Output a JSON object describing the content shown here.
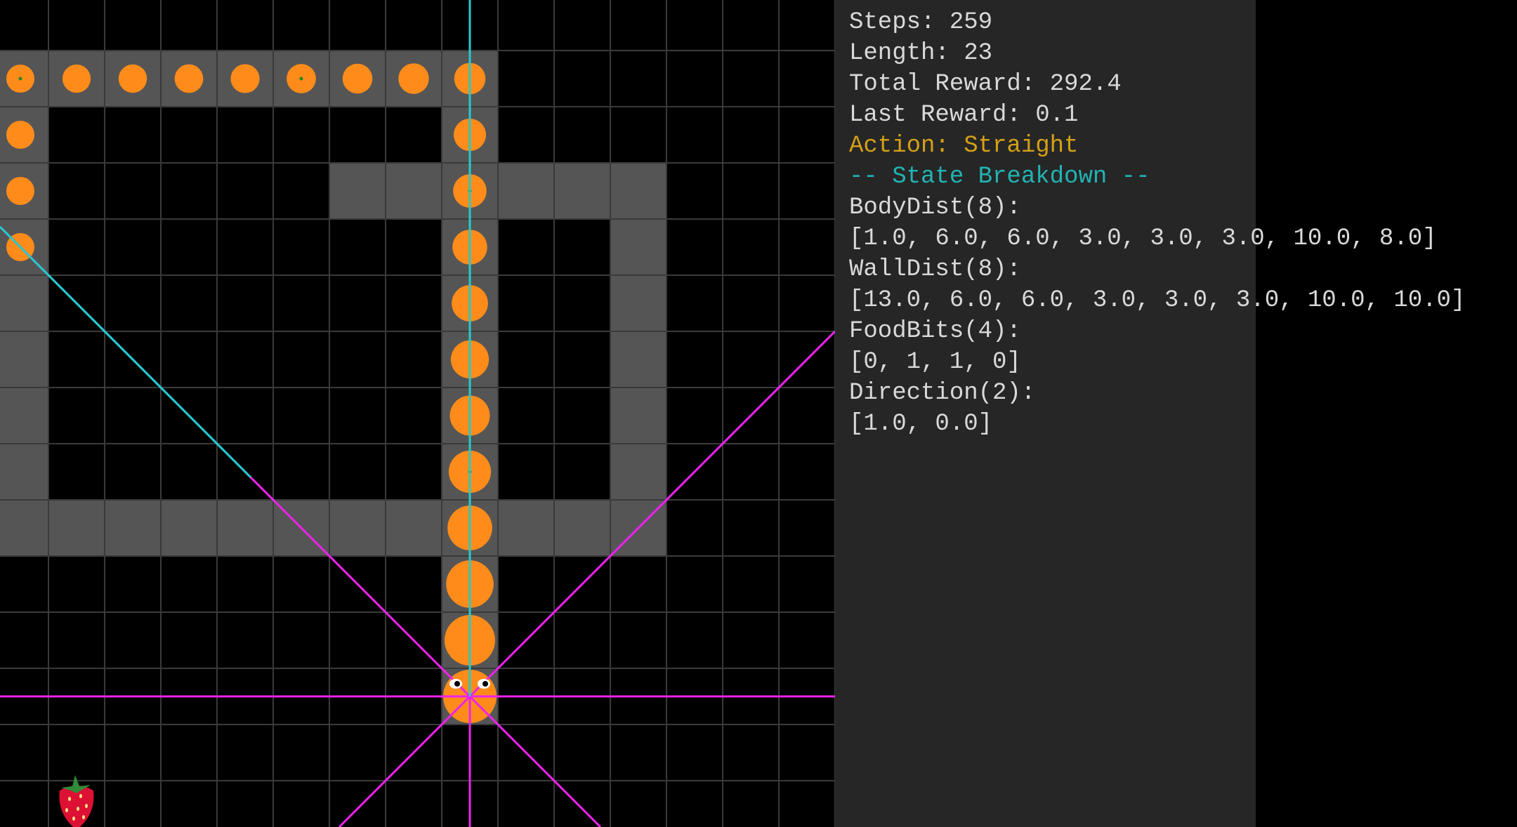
{
  "hud": {
    "lines": [
      {
        "text": "Steps: 259",
        "kind": "normal"
      },
      {
        "text": "Length: 23",
        "kind": "normal"
      },
      {
        "text": "Total Reward: 292.4",
        "kind": "normal"
      },
      {
        "text": "Last Reward: 0.1",
        "kind": "normal"
      },
      {
        "text": "Action: Straight",
        "kind": "action"
      },
      {
        "text": "-- State Breakdown --",
        "kind": "header"
      },
      {
        "text": "BodyDist(8):",
        "kind": "normal"
      },
      {
        "text": "[1.0, 6.0, 6.0, 3.0, 3.0, 3.0, 10.0, 8.0]",
        "kind": "normal"
      },
      {
        "text": "WallDist(8):",
        "kind": "normal"
      },
      {
        "text": "[13.0, 6.0, 6.0, 3.0, 3.0, 3.0, 10.0, 10.0]",
        "kind": "normal"
      },
      {
        "text": "FoodBits(4):",
        "kind": "normal"
      },
      {
        "text": "[0, 1, 1, 0]",
        "kind": "normal"
      },
      {
        "text": "Direction(2):",
        "kind": "normal"
      },
      {
        "text": "[1.0, 0.0]",
        "kind": "normal"
      }
    ]
  },
  "board": {
    "columns": 15,
    "rows": 15,
    "colors": {
      "background": "#000000",
      "grid": "#3a3a3a",
      "wall": "#555555",
      "snake": "#ff8c1a",
      "body_ray": "#22cccc",
      "wall_ray": "#ee22ee",
      "food": "#dd1133",
      "panel": "#262626"
    },
    "walls": [
      [
        0,
        0
      ],
      [
        1,
        0
      ],
      [
        2,
        0
      ],
      [
        3,
        0
      ],
      [
        4,
        0
      ],
      [
        5,
        0
      ],
      [
        6,
        0
      ],
      [
        7,
        0
      ],
      [
        8,
        0
      ],
      [
        0,
        1
      ],
      [
        8,
        1
      ],
      [
        0,
        2
      ],
      [
        6,
        2
      ],
      [
        7,
        2
      ],
      [
        8,
        2
      ],
      [
        9,
        2
      ],
      [
        10,
        2
      ],
      [
        11,
        2
      ],
      [
        0,
        3
      ],
      [
        8,
        3
      ],
      [
        11,
        3
      ],
      [
        0,
        4
      ],
      [
        8,
        4
      ],
      [
        11,
        4
      ],
      [
        0,
        5
      ],
      [
        8,
        5
      ],
      [
        11,
        5
      ],
      [
        0,
        6
      ],
      [
        8,
        6
      ],
      [
        11,
        6
      ],
      [
        0,
        7
      ],
      [
        8,
        7
      ],
      [
        11,
        7
      ],
      [
        0,
        8
      ],
      [
        1,
        8
      ],
      [
        2,
        8
      ],
      [
        3,
        8
      ],
      [
        4,
        8
      ],
      [
        5,
        8
      ],
      [
        6,
        8
      ],
      [
        7,
        8
      ],
      [
        8,
        8
      ],
      [
        9,
        8
      ],
      [
        10,
        8
      ],
      [
        11,
        8
      ],
      [
        8,
        9
      ],
      [
        8,
        10
      ],
      [
        8,
        11
      ]
    ],
    "snake_head": [
      8,
      11
    ],
    "snake_body": [
      [
        8,
        10
      ],
      [
        8,
        9
      ],
      [
        8,
        8
      ],
      [
        8,
        7
      ],
      [
        8,
        6
      ],
      [
        8,
        5
      ],
      [
        8,
        4
      ],
      [
        8,
        3
      ],
      [
        8,
        2
      ],
      [
        8,
        1
      ],
      [
        8,
        0
      ],
      [
        7,
        0
      ],
      [
        6,
        0
      ],
      [
        5,
        0
      ],
      [
        4,
        0
      ],
      [
        3,
        0
      ],
      [
        2,
        0
      ],
      [
        1,
        0
      ],
      [
        0,
        0
      ],
      [
        0,
        1
      ],
      [
        0,
        2
      ],
      [
        0,
        3
      ]
    ],
    "food": [
      1,
      13
    ],
    "head_direction": "up",
    "body_rays": [
      {
        "dx": 0,
        "dy": -1
      },
      {
        "dx": -1,
        "dy": -1
      }
    ],
    "wall_rays": [
      {
        "dx": 0,
        "dy": -1
      },
      {
        "dx": 1,
        "dy": -1
      },
      {
        "dx": 1,
        "dy": 0
      },
      {
        "dx": 1,
        "dy": 1
      },
      {
        "dx": 0,
        "dy": 1
      },
      {
        "dx": -1,
        "dy": 1
      },
      {
        "dx": -1,
        "dy": 0
      },
      {
        "dx": -1,
        "dy": -1
      }
    ]
  }
}
